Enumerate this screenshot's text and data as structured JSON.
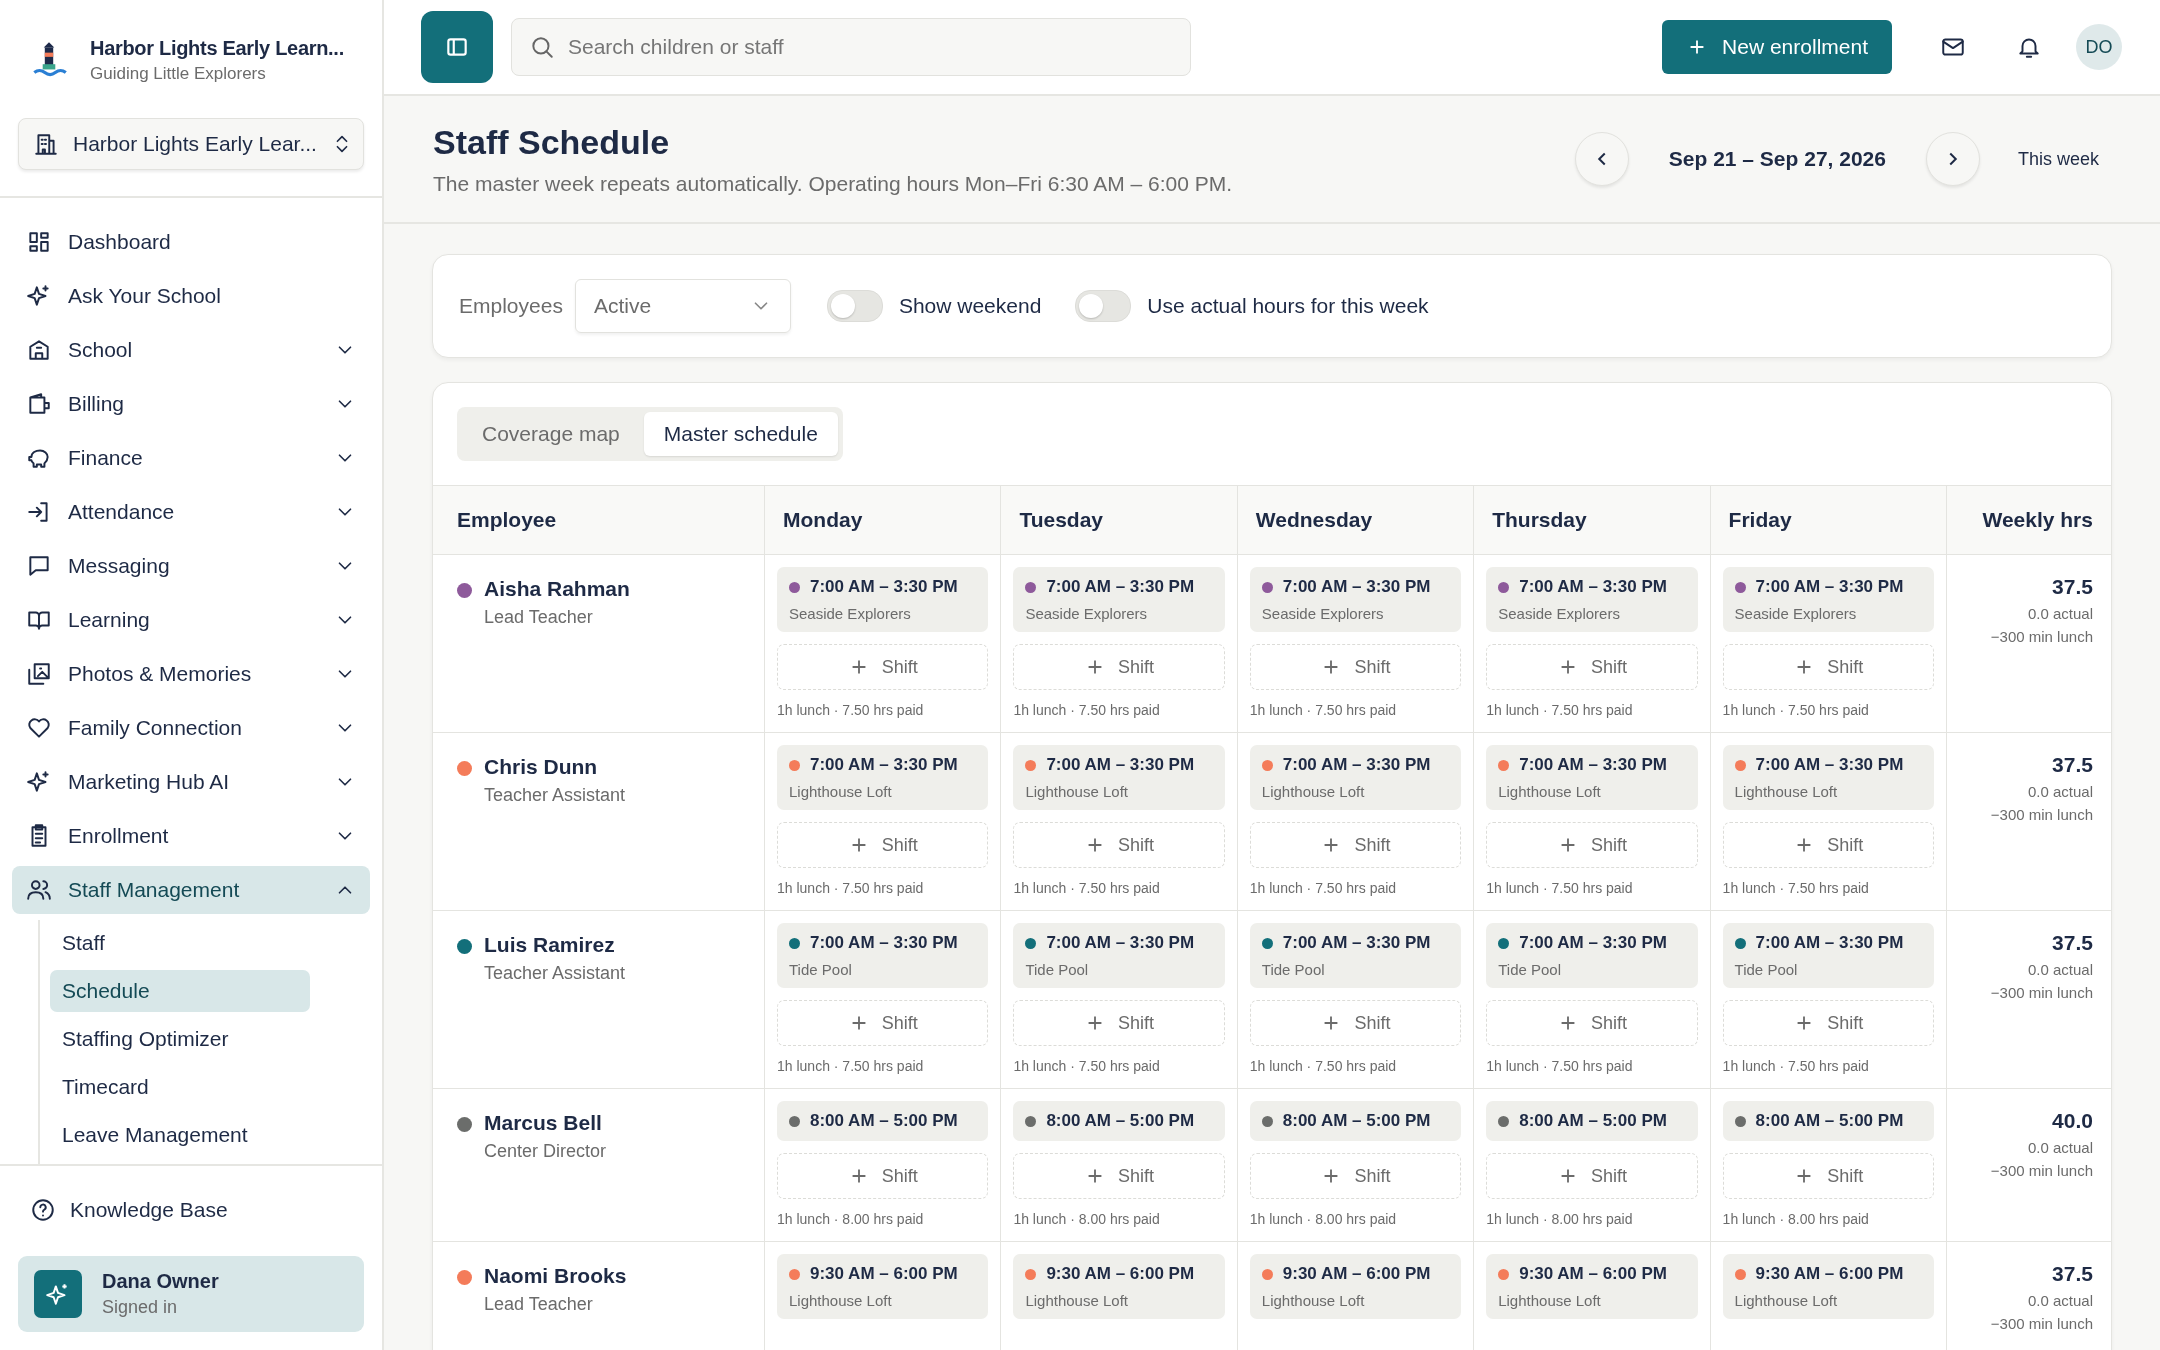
{
  "brand": {
    "name": "Harbor Lights Early Learn...",
    "tagline": "Guiding Little Explorers"
  },
  "school_switcher": {
    "label": "Harbor Lights Early Lear..."
  },
  "nav": [
    {
      "label": "Dashboard",
      "kind": "link",
      "selected": false
    },
    {
      "label": "Ask Your School",
      "kind": "link",
      "selected": false
    },
    {
      "label": "School",
      "kind": "group",
      "expanded": false,
      "selected": false
    },
    {
      "label": "Billing",
      "kind": "group",
      "expanded": false,
      "selected": false
    },
    {
      "label": "Finance",
      "kind": "group",
      "expanded": false,
      "selected": false
    },
    {
      "label": "Attendance",
      "kind": "group",
      "expanded": false,
      "selected": false
    },
    {
      "label": "Messaging",
      "kind": "group",
      "expanded": false,
      "selected": false
    },
    {
      "label": "Learning",
      "kind": "group",
      "expanded": false,
      "selected": false
    },
    {
      "label": "Photos & Memories",
      "kind": "group",
      "expanded": false,
      "selected": false
    },
    {
      "label": "Family Connection",
      "kind": "group",
      "expanded": false,
      "selected": false
    },
    {
      "label": "Marketing Hub AI",
      "kind": "group",
      "expanded": false,
      "selected": false
    },
    {
      "label": "Enrollment",
      "kind": "group",
      "expanded": false,
      "selected": false
    },
    {
      "label": "Staff Management",
      "kind": "group",
      "expanded": true,
      "selected": true,
      "children": [
        {
          "label": "Staff",
          "selected": false
        },
        {
          "label": "Schedule",
          "selected": true
        },
        {
          "label": "Staffing Optimizer",
          "selected": false
        },
        {
          "label": "Timecard",
          "selected": false
        },
        {
          "label": "Leave Management",
          "selected": false
        }
      ]
    }
  ],
  "knowledge_base": "Knowledge Base",
  "user": {
    "name": "Dana Owner",
    "status": "Signed in"
  },
  "topbar": {
    "search_placeholder": "Search children or staff",
    "new_button": "New enrollment",
    "avatar": "DO"
  },
  "page": {
    "title": "Staff Schedule",
    "subtitle": "The master week repeats automatically. Operating hours Mon–Fri 6:30 AM – 6:00 PM.",
    "date_range": "Sep 21 – Sep 27, 2026",
    "this_week": "This week"
  },
  "filters": {
    "label": "Employees",
    "value": "Active",
    "toggles": [
      {
        "label": "Show weekend",
        "on": false
      },
      {
        "label": "Use actual hours for this week",
        "on": false
      }
    ]
  },
  "view_tabs": [
    {
      "label": "Coverage map",
      "selected": false
    },
    {
      "label": "Master schedule",
      "selected": true
    }
  ],
  "table": {
    "columns": [
      "Employee",
      "Monday",
      "Tuesday",
      "Wednesday",
      "Thursday",
      "Friday",
      "Weekly hrs"
    ],
    "rows": [
      {
        "name": "Aisha Rahman",
        "role": "Lead Teacher",
        "color": "#8e5a9b",
        "days": [
          {
            "time": "7:00 AM – 3:30 PM",
            "room": "Seaside Explorers",
            "add": "Shift",
            "note": "1h lunch · 7.50 hrs paid"
          },
          {
            "time": "7:00 AM – 3:30 PM",
            "room": "Seaside Explorers",
            "add": "Shift",
            "note": "1h lunch · 7.50 hrs paid"
          },
          {
            "time": "7:00 AM – 3:30 PM",
            "room": "Seaside Explorers",
            "add": "Shift",
            "note": "1h lunch · 7.50 hrs paid"
          },
          {
            "time": "7:00 AM – 3:30 PM",
            "room": "Seaside Explorers",
            "add": "Shift",
            "note": "1h lunch · 7.50 hrs paid"
          },
          {
            "time": "7:00 AM – 3:30 PM",
            "room": "Seaside Explorers",
            "add": "Shift",
            "note": "1h lunch · 7.50 hrs paid"
          }
        ],
        "weekly": {
          "total": "37.5",
          "actual": "0.0 actual",
          "lunch": "−300 min lunch"
        }
      },
      {
        "name": "Chris Dunn",
        "role": "Teacher Assistant",
        "color": "#f47c5a",
        "days": [
          {
            "time": "7:00 AM – 3:30 PM",
            "room": "Lighthouse Loft",
            "add": "Shift",
            "note": "1h lunch · 7.50 hrs paid"
          },
          {
            "time": "7:00 AM – 3:30 PM",
            "room": "Lighthouse Loft",
            "add": "Shift",
            "note": "1h lunch · 7.50 hrs paid"
          },
          {
            "time": "7:00 AM – 3:30 PM",
            "room": "Lighthouse Loft",
            "add": "Shift",
            "note": "1h lunch · 7.50 hrs paid"
          },
          {
            "time": "7:00 AM – 3:30 PM",
            "room": "Lighthouse Loft",
            "add": "Shift",
            "note": "1h lunch · 7.50 hrs paid"
          },
          {
            "time": "7:00 AM – 3:30 PM",
            "room": "Lighthouse Loft",
            "add": "Shift",
            "note": "1h lunch · 7.50 hrs paid"
          }
        ],
        "weekly": {
          "total": "37.5",
          "actual": "0.0 actual",
          "lunch": "−300 min lunch"
        }
      },
      {
        "name": "Luis Ramirez",
        "role": "Teacher Assistant",
        "color": "#136f7a",
        "days": [
          {
            "time": "7:00 AM – 3:30 PM",
            "room": "Tide Pool",
            "add": "Shift",
            "note": "1h lunch · 7.50 hrs paid"
          },
          {
            "time": "7:00 AM – 3:30 PM",
            "room": "Tide Pool",
            "add": "Shift",
            "note": "1h lunch · 7.50 hrs paid"
          },
          {
            "time": "7:00 AM – 3:30 PM",
            "room": "Tide Pool",
            "add": "Shift",
            "note": "1h lunch · 7.50 hrs paid"
          },
          {
            "time": "7:00 AM – 3:30 PM",
            "room": "Tide Pool",
            "add": "Shift",
            "note": "1h lunch · 7.50 hrs paid"
          },
          {
            "time": "7:00 AM – 3:30 PM",
            "room": "Tide Pool",
            "add": "Shift",
            "note": "1h lunch · 7.50 hrs paid"
          }
        ],
        "weekly": {
          "total": "37.5",
          "actual": "0.0 actual",
          "lunch": "−300 min lunch"
        }
      },
      {
        "name": "Marcus Bell",
        "role": "Center Director",
        "color": "#6b6d6b",
        "days": [
          {
            "time": "8:00 AM – 5:00 PM",
            "add": "Shift",
            "note": "1h lunch · 8.00 hrs paid"
          },
          {
            "time": "8:00 AM – 5:00 PM",
            "add": "Shift",
            "note": "1h lunch · 8.00 hrs paid"
          },
          {
            "time": "8:00 AM – 5:00 PM",
            "add": "Shift",
            "note": "1h lunch · 8.00 hrs paid"
          },
          {
            "time": "8:00 AM – 5:00 PM",
            "add": "Shift",
            "note": "1h lunch · 8.00 hrs paid"
          },
          {
            "time": "8:00 AM – 5:00 PM",
            "add": "Shift",
            "note": "1h lunch · 8.00 hrs paid"
          }
        ],
        "weekly": {
          "total": "40.0",
          "actual": "0.0 actual",
          "lunch": "−300 min lunch"
        }
      },
      {
        "name": "Naomi Brooks",
        "role": "Lead Teacher",
        "color": "#f47c5a",
        "days": [
          {
            "time": "9:30 AM – 6:00 PM",
            "room": "Lighthouse Loft"
          },
          {
            "time": "9:30 AM – 6:00 PM",
            "room": "Lighthouse Loft"
          },
          {
            "time": "9:30 AM – 6:00 PM",
            "room": "Lighthouse Loft"
          },
          {
            "time": "9:30 AM – 6:00 PM",
            "room": "Lighthouse Loft"
          },
          {
            "time": "9:30 AM – 6:00 PM",
            "room": "Lighthouse Loft"
          }
        ],
        "weekly": {
          "total": "37.5",
          "actual": "0.0 actual",
          "lunch": "−300 min lunch"
        }
      }
    ]
  }
}
